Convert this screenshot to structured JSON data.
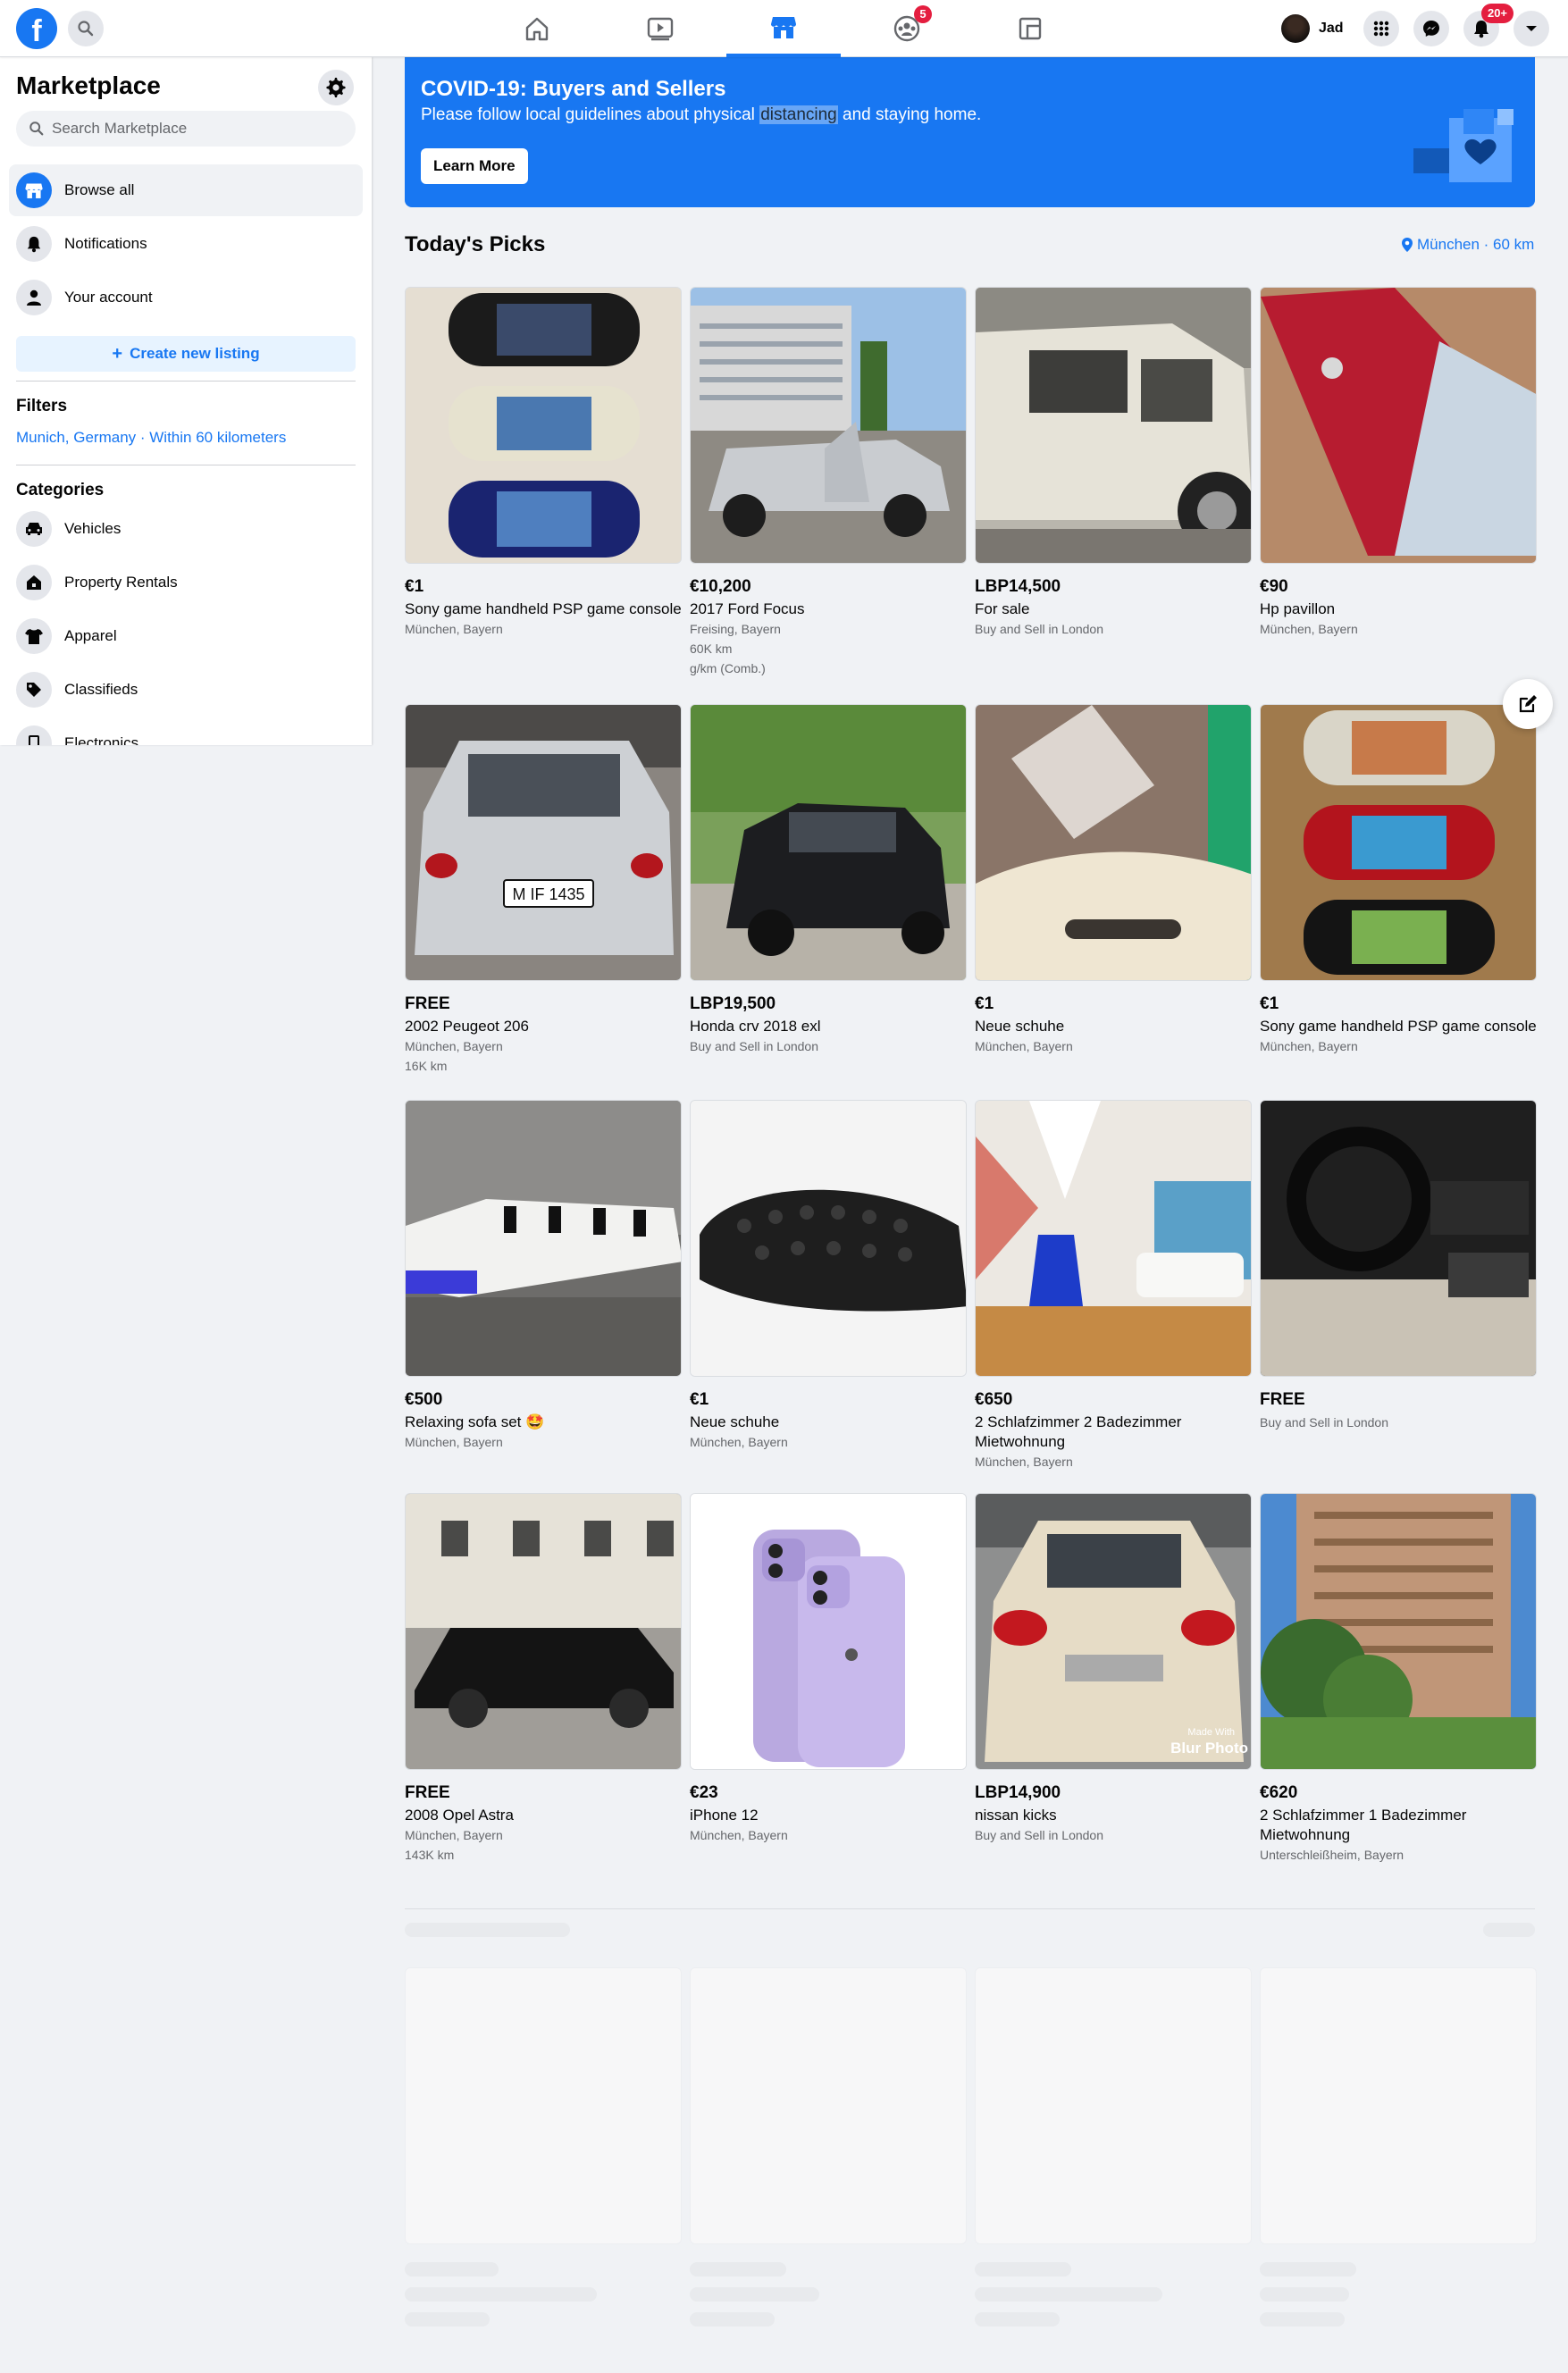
{
  "nav": {
    "profile_name": "Jad",
    "watch_badge": "5",
    "notifications_badge": "20+"
  },
  "sidebar": {
    "title": "Marketplace",
    "search_placeholder": "Search Marketplace",
    "items": [
      {
        "label": "Browse all",
        "icon": "storefront-icon"
      },
      {
        "label": "Notifications",
        "icon": "bell-icon"
      },
      {
        "label": "Your account",
        "icon": "person-icon"
      }
    ],
    "create_label": "Create new listing",
    "filters_heading": "Filters",
    "filter_location": "Munich, Germany · Within 60 kilometers",
    "categories_heading": "Categories",
    "categories": [
      {
        "label": "Vehicles",
        "icon": "car-icon"
      },
      {
        "label": "Property Rentals",
        "icon": "house-icon"
      },
      {
        "label": "Apparel",
        "icon": "shirt-icon"
      },
      {
        "label": "Classifieds",
        "icon": "tag-icon"
      },
      {
        "label": "Electronics",
        "icon": "phone-icon"
      }
    ]
  },
  "banner": {
    "title": "COVID-19: Buyers and Sellers",
    "text_before": "Please follow local guidelines about physical ",
    "text_highlight": "distancing",
    "text_after": " and staying home.",
    "button": "Learn More"
  },
  "picks": {
    "title": "Today's Picks",
    "location": "München · 60 km"
  },
  "listings": [
    {
      "price": "€1",
      "title": "Sony game handheld PSP game console",
      "meta": [
        "München, Bayern"
      ],
      "image": "psp-consoles"
    },
    {
      "price": "€10,200",
      "title": "2017 Ford Focus",
      "meta": [
        "Freising, Bayern",
        "60K km",
        "g/km (Comb.)"
      ],
      "image": "ford-focus"
    },
    {
      "price": "LBP14,500",
      "title": "For sale",
      "meta": [
        "Buy and Sell in London"
      ],
      "image": "jeep"
    },
    {
      "price": "€90",
      "title": "Hp pavillon",
      "meta": [
        "München, Bayern"
      ],
      "image": "laptop"
    },
    {
      "price": "FREE",
      "title": "2002 Peugeot 206",
      "meta": [
        "München, Bayern",
        "16K km"
      ],
      "image": "peugeot"
    },
    {
      "price": "LBP19,500",
      "title": "Honda crv 2018 exl",
      "meta": [
        "Buy and Sell in London"
      ],
      "image": "honda-suv"
    },
    {
      "price": "€1",
      "title": "Neue schuhe",
      "meta": [
        "München, Bayern"
      ],
      "image": "shoe-closeup"
    },
    {
      "price": "€1",
      "title": "Sony game handheld PSP game console",
      "meta": [
        "München, Bayern"
      ],
      "image": "psp-red"
    },
    {
      "price": "€500",
      "title": "Relaxing sofa set 🤩",
      "meta": [
        "München, Bayern"
      ],
      "image": "sofa"
    },
    {
      "price": "€1",
      "title": "Neue schuhe",
      "meta": [
        "München, Bayern"
      ],
      "image": "shoe-sole"
    },
    {
      "price": "€650",
      "title": "2 Schlafzimmer 2 Badezimmer Mietwohnung",
      "meta": [
        "München, Bayern"
      ],
      "image": "attic-room"
    },
    {
      "price": "FREE",
      "title": "",
      "meta": [
        "Buy and Sell in London"
      ],
      "image": "car-interior"
    },
    {
      "price": "FREE",
      "title": "2008 Opel Astra",
      "meta": [
        "München, Bayern",
        "143K km"
      ],
      "image": "opel"
    },
    {
      "price": "€23",
      "title": "iPhone 12",
      "meta": [
        "München, Bayern"
      ],
      "image": "iphone"
    },
    {
      "price": "LBP14,900",
      "title": "nissan kicks",
      "meta": [
        "Buy and Sell in London"
      ],
      "image": "nissan",
      "watermark": [
        "Made With",
        "Blur Photo"
      ]
    },
    {
      "price": "€620",
      "title": "2 Schlafzimmer 1 Badezimmer Mietwohnung",
      "meta": [
        "Unterschleißheim, Bayern"
      ],
      "image": "apartment-tower"
    }
  ],
  "colors": {
    "brand": "#1877f2",
    "badge": "#e41e3f",
    "background": "#f0f2f5"
  }
}
